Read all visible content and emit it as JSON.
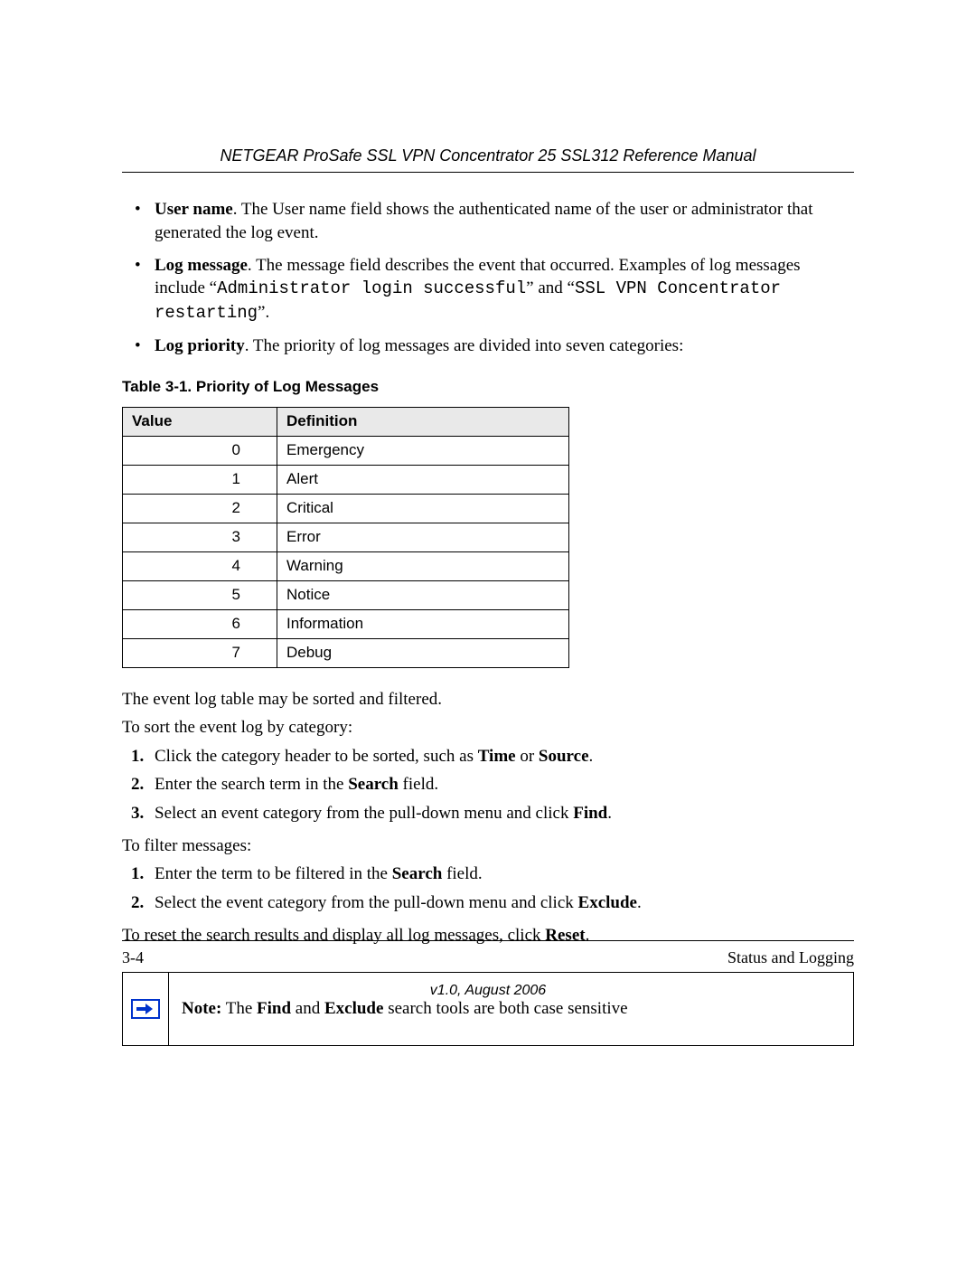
{
  "header": {
    "manual_title": "NETGEAR ProSafe SSL VPN Concentrator 25 SSL312 Reference Manual"
  },
  "bullets": {
    "username": {
      "label": "User name",
      "text": ". The User name field shows the authenticated name of the user or administrator that generated the log event."
    },
    "logmessage": {
      "label": "Log message",
      "text_before_code1": ". The message field describes the event that occurred. Examples of log messages include “",
      "code1": "Administrator login successful",
      "text_mid": "” and “",
      "code2": "SSL VPN Concentrator restarting",
      "text_after": "”."
    },
    "logpriority": {
      "label": "Log priority",
      "text": ". The priority of log messages are divided into seven categories:"
    }
  },
  "table": {
    "caption": "Table 3-1. Priority of Log Messages",
    "headers": {
      "value": "Value",
      "definition": "Definition"
    },
    "rows": [
      {
        "value": "0",
        "def": "Emergency"
      },
      {
        "value": "1",
        "def": "Alert"
      },
      {
        "value": "2",
        "def": "Critical"
      },
      {
        "value": "3",
        "def": "Error"
      },
      {
        "value": "4",
        "def": "Warning"
      },
      {
        "value": "5",
        "def": "Notice"
      },
      {
        "value": "6",
        "def": "Information"
      },
      {
        "value": "7",
        "def": "Debug"
      }
    ]
  },
  "body": {
    "p1": "The event log table may be sorted and filtered.",
    "p2": "To sort the event log by category:",
    "sort_steps": {
      "s1_before": "Click the category header to be sorted, such as ",
      "s1_b1": "Time",
      "s1_mid": " or ",
      "s1_b2": "Source",
      "s1_after": ".",
      "s2_before": "Enter the search term in the ",
      "s2_b": "Search",
      "s2_after": " field.",
      "s3_before": "Select an event category from the pull-down menu and click ",
      "s3_b": "Find",
      "s3_after": "."
    },
    "p3": "To filter messages:",
    "filter_steps": {
      "f1_before": "Enter the term to be filtered in the ",
      "f1_b": "Search",
      "f1_after": " field.",
      "f2_before": "Select the event category from the pull-down menu and click ",
      "f2_b": "Exclude",
      "f2_after": "."
    },
    "p4_before": "To reset the search results and display all log messages, click ",
    "p4_b": "Reset",
    "p4_after": "."
  },
  "note": {
    "label": "Note:",
    "before1": " The ",
    "b1": "Find",
    "mid": " and ",
    "b2": "Exclude",
    "after": " search tools are both case sensitive"
  },
  "footer": {
    "page": "3-4",
    "section": "Status and Logging",
    "version": "v1.0, August 2006"
  }
}
